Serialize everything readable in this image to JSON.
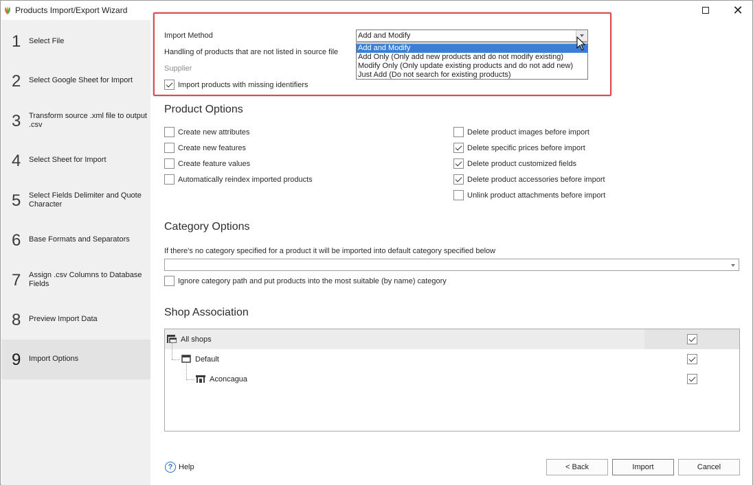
{
  "window": {
    "title": "Products Import/Export Wizard",
    "app_icon": "leaf-logo-icon",
    "maximize_icon": "maximize-icon",
    "close_icon": "close-icon"
  },
  "steps": [
    {
      "num": "1",
      "label": "Select File"
    },
    {
      "num": "2",
      "label": "Select Google Sheet for Import"
    },
    {
      "num": "3",
      "label": "Transform source .xml file to output .csv"
    },
    {
      "num": "4",
      "label": "Select Sheet for Import"
    },
    {
      "num": "5",
      "label": "Select Fields Delimiter and Quote Character"
    },
    {
      "num": "6",
      "label": "Base Formats and Separators"
    },
    {
      "num": "7",
      "label": "Assign .csv Columns to Database Fields"
    },
    {
      "num": "8",
      "label": "Preview Import Data"
    },
    {
      "num": "9",
      "label": "Import Options",
      "active": true
    }
  ],
  "import_method": {
    "label": "Import Method",
    "selected_value": "Add and Modify",
    "options": [
      "Add and Modify",
      "Add Only (Only add new products and do not modify existing)",
      "Modify Only (Only update existing products and do not add new)",
      "Just Add (Do not search for existing products)"
    ],
    "highlighted_option": "Add and Modify"
  },
  "handling_label": "Handling of products that are not listed in source file",
  "supplier_label": "Supplier",
  "missing_identifiers": {
    "label": "Import products with missing identifiers",
    "checked": true
  },
  "product_options": {
    "heading": "Product Options",
    "left": [
      {
        "label": "Create new attributes",
        "checked": false
      },
      {
        "label": "Create new features",
        "checked": false
      },
      {
        "label": "Create feature values",
        "checked": false
      },
      {
        "label": "Automatically reindex imported products",
        "checked": false
      }
    ],
    "right": [
      {
        "label": "Delete product images before import",
        "checked": false
      },
      {
        "label": "Delete specific prices before import",
        "checked": true
      },
      {
        "label": "Delete product customized fields",
        "checked": true
      },
      {
        "label": "Delete product accessories before import",
        "checked": true
      },
      {
        "label": "Unlink product attachments before import",
        "checked": false
      }
    ]
  },
  "category_options": {
    "heading": "Category Options",
    "description": "If there's no category specified for a product it will be imported into default category specified below",
    "default_category_value": "",
    "ignore_path": {
      "label": "Ignore category path and put products into the most suitable (by name) category",
      "checked": false
    }
  },
  "shop_association": {
    "heading": "Shop Association",
    "rows": [
      {
        "label": "All shops",
        "checked": true,
        "icon": "shop-group-icon"
      },
      {
        "label": "Default",
        "checked": true,
        "icon": "shop-window-icon"
      },
      {
        "label": "Aconcagua",
        "checked": true,
        "icon": "shop-icon"
      }
    ]
  },
  "footer": {
    "help_label": "Help",
    "help_icon": "help-circle-icon",
    "back_label": "< Back",
    "import_label": "Import",
    "cancel_label": "Cancel"
  },
  "colors": {
    "highlight_border": "#e0474c",
    "selection_blue": "#3a7fd4",
    "step_panel_bg": "#f0f0f0"
  }
}
